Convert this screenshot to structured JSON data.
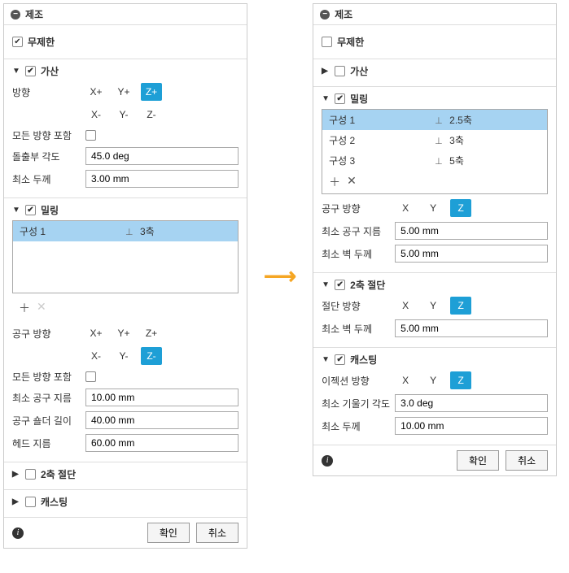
{
  "panel_title": "제조",
  "labels": {
    "unlimited": "무제한",
    "additive": "가산",
    "direction": "방향",
    "all_dirs": "모든 방향 포함",
    "protrusion_angle": "돌출부 각도",
    "min_thickness": "최소 두께",
    "milling": "밀링",
    "config1": "구성 1",
    "config2": "구성 2",
    "config3": "구성 3",
    "axis3": "3축",
    "axis25": "2.5축",
    "axis5": "5축",
    "tool_dir": "공구 방향",
    "min_tool_dia": "최소 공구 지름",
    "tool_shoulder_len": "공구 숄더 길이",
    "head_dia": "헤드 지름",
    "min_wall_thick": "최소 벽 두께",
    "two_axis_cut": "2축 절단",
    "cut_dir": "절단 방향",
    "casting": "캐스팅",
    "ejection_dir": "이젝션 방향",
    "min_draft_angle": "최소 기울기 각도",
    "ok": "확인",
    "cancel": "취소"
  },
  "left": {
    "unlimited_checked": true,
    "additive": {
      "checked": true,
      "expanded": true,
      "protrusion_angle": "45.0 deg",
      "min_thickness": "3.00 mm",
      "dir_selected": "Z+"
    },
    "milling": {
      "checked": true,
      "expanded": true,
      "config_axis": "3축",
      "dir_selected": "Z-",
      "min_tool_dia": "10.00 mm",
      "tool_shoulder_len": "40.00 mm",
      "head_dia": "60.00 mm"
    },
    "two_axis_cut": {
      "checked": false,
      "expanded": false
    },
    "casting": {
      "checked": false,
      "expanded": false
    }
  },
  "right": {
    "unlimited_checked": false,
    "additive": {
      "checked": false,
      "expanded": false
    },
    "milling": {
      "checked": true,
      "expanded": true,
      "configs": [
        {
          "name": "구성 1",
          "axis": "2.5축",
          "selected": true
        },
        {
          "name": "구성 2",
          "axis": "3축",
          "selected": false
        },
        {
          "name": "구성 3",
          "axis": "5축",
          "selected": false
        }
      ],
      "dir_selected": "Z",
      "min_tool_dia": "5.00 mm",
      "min_wall_thick": "5.00 mm"
    },
    "two_axis_cut": {
      "checked": true,
      "expanded": true,
      "dir_selected": "Z",
      "min_wall_thick": "5.00 mm"
    },
    "casting": {
      "checked": true,
      "expanded": true,
      "dir_selected": "Z",
      "min_draft_angle": "3.0 deg",
      "min_thickness": "10.00 mm"
    }
  },
  "axes_pm": [
    "X+",
    "Y+",
    "Z+",
    "X-",
    "Y-",
    "Z-"
  ],
  "axes": [
    "X",
    "Y",
    "Z"
  ]
}
